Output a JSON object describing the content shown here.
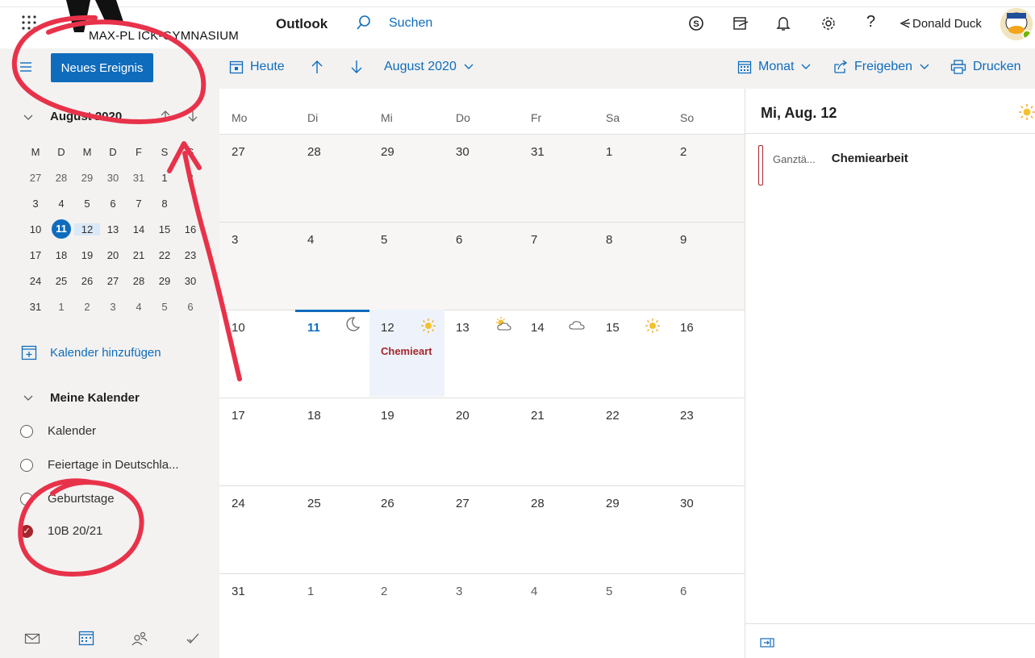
{
  "header": {
    "school": "MAX-PL ICK-GYMNASIUM",
    "app": "Outlook",
    "search": "Suchen",
    "user": "Donald Duck"
  },
  "toolbar": {
    "new_event": "Neues Ereignis",
    "today": "Heute",
    "month_label": "August 2020",
    "view": "Monat",
    "share": "Freigeben",
    "print": "Drucken"
  },
  "mini_calendar": {
    "title": "August 2020",
    "weekdays": [
      "M",
      "D",
      "M",
      "D",
      "F",
      "S",
      "S"
    ],
    "weeks": [
      [
        "27",
        "28",
        "29",
        "30",
        "31",
        "1",
        "2"
      ],
      [
        "3",
        "4",
        "5",
        "6",
        "7",
        "8",
        ""
      ],
      [
        "10",
        "11",
        "12",
        "13",
        "14",
        "15",
        "16"
      ],
      [
        "17",
        "18",
        "19",
        "20",
        "21",
        "22",
        "23"
      ],
      [
        "24",
        "25",
        "26",
        "27",
        "28",
        "29",
        "30"
      ],
      [
        "31",
        "1",
        "2",
        "3",
        "4",
        "5",
        "6"
      ]
    ]
  },
  "sidebar": {
    "add_calendar": "Kalender hinzufügen",
    "my_calendars": "Meine Kalender",
    "calendars": [
      "Kalender",
      "Feiertage in Deutschla...",
      "Geburtstage",
      "10B 20/21"
    ]
  },
  "month": {
    "weekdays": [
      "Mo",
      "Di",
      "Mi",
      "Do",
      "Fr",
      "Sa",
      "So"
    ],
    "weeks": [
      [
        "27",
        "28",
        "29",
        "30",
        "31",
        "1",
        "2"
      ],
      [
        "3",
        "4",
        "5",
        "6",
        "7",
        "8",
        "9"
      ],
      [
        "10",
        "11",
        "12",
        "13",
        "14",
        "15",
        "16"
      ],
      [
        "17",
        "18",
        "19",
        "20",
        "21",
        "22",
        "23"
      ],
      [
        "24",
        "25",
        "26",
        "27",
        "28",
        "29",
        "30"
      ],
      [
        "31",
        "1",
        "2",
        "3",
        "4",
        "5",
        "6"
      ]
    ],
    "event_label": "Chemieart"
  },
  "panel": {
    "title": "Mi, Aug. 12",
    "allday": "Ganztä...",
    "event": "Chemiearbeit"
  },
  "colors": {
    "accent": "#0f6cbd",
    "event": "#a4262c",
    "annotation": "#e8324a"
  }
}
